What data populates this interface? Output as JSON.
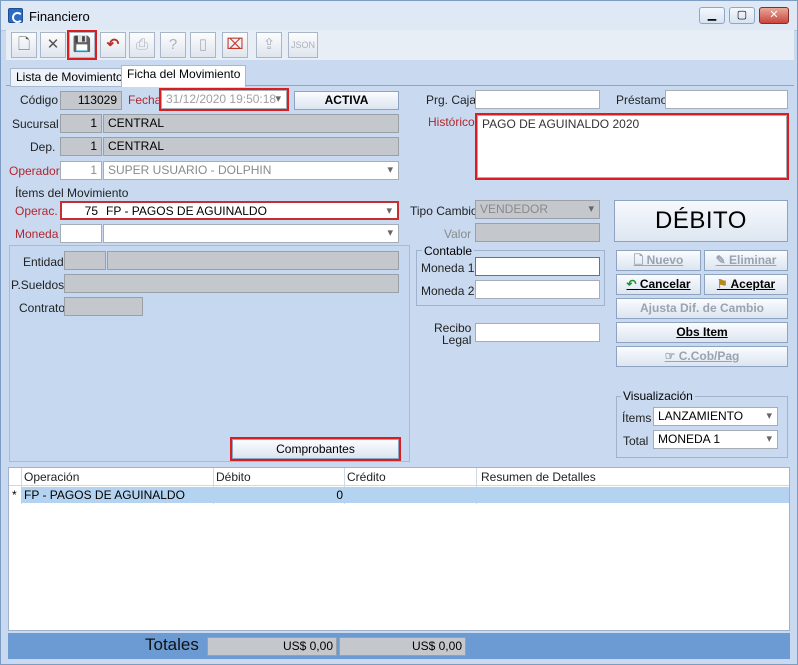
{
  "window": {
    "title": "Financiero",
    "min": "▁",
    "max": "▢",
    "close": "✕"
  },
  "toolbar": {
    "new": "🗋",
    "delete": "✕",
    "save": "💾",
    "undo": "↶",
    "print": "⎙",
    "help": "?",
    "book": "▯",
    "fax": "⌧",
    "export": "⇪",
    "json": "JSON"
  },
  "tabs": [
    {
      "label": "Lista de Movimientos"
    },
    {
      "label": "Ficha del Movimiento"
    }
  ],
  "form": {
    "codigo_label": "Código",
    "codigo": "113029",
    "fecha_label": "Fecha",
    "fecha": "31/12/2020 19:50:18",
    "estado": "ACTIVA",
    "sucursal_label": "Sucursal",
    "sucursal_num": "1",
    "sucursal": "CENTRAL",
    "dep_label": "Dep.",
    "dep_num": "1",
    "dep": "CENTRAL",
    "operador_label": "Operador",
    "operador_num": "1",
    "operador": "SUPER USUARIO - DOLPHIN",
    "prg_caja_label": "Prg. Caja",
    "prg_caja": "",
    "prestamo_label": "Préstamo",
    "prestamo": "",
    "historico_label": "Histórico",
    "historico": "PAGO DE AGUINALDO 2020"
  },
  "items": {
    "title": "Ítems del Movimiento",
    "operac_label": "Operac.",
    "operac_num": "75",
    "operac": "FP - PAGOS DE AGUINALDO",
    "moneda_label": "Moneda",
    "moneda_num": "",
    "moneda": "",
    "entidad_label": "Entidad",
    "psueldos_label": "P.Sueldos",
    "contrato_label": "Contrato",
    "comprobantes": "Comprobantes",
    "tipo_cambio_label": "Tipo Cambio",
    "tipo_cambio": "VENDEDOR",
    "valor_label": "Valor",
    "valor": "",
    "contable_label": "Contable",
    "moneda1_label": "Moneda 1",
    "moneda1": "",
    "moneda2_label": "Moneda 2",
    "moneda2": "",
    "recibo_label_1": "Recibo",
    "recibo_label_2": "Legal",
    "recibo": "",
    "debito": "DÉBITO"
  },
  "actions": {
    "nuevo": "Nuevo",
    "eliminar": "Eliminar",
    "cancelar": "Cancelar",
    "aceptar": "Aceptar",
    "ajusta": "Ajusta Dif. de Cambio",
    "obs": "Obs Item",
    "ccob": "C.Cob/Pag"
  },
  "visualizacion": {
    "title": "Visualización",
    "items_label": "Ítems",
    "items": "LANZAMIENTO",
    "total_label": "Total",
    "total": "MONEDA 1"
  },
  "grid": {
    "columns": [
      "Operación",
      "Débito",
      "Crédito",
      "Resumen de Detalles"
    ],
    "rows": [
      {
        "marker": "*",
        "operacion": "FP - PAGOS DE AGUINALDO",
        "debito": "0",
        "credito": "",
        "resumen": ""
      }
    ]
  },
  "totals": {
    "label": "Totales",
    "debito": "US$ 0,00",
    "credito": "US$ 0,00"
  }
}
